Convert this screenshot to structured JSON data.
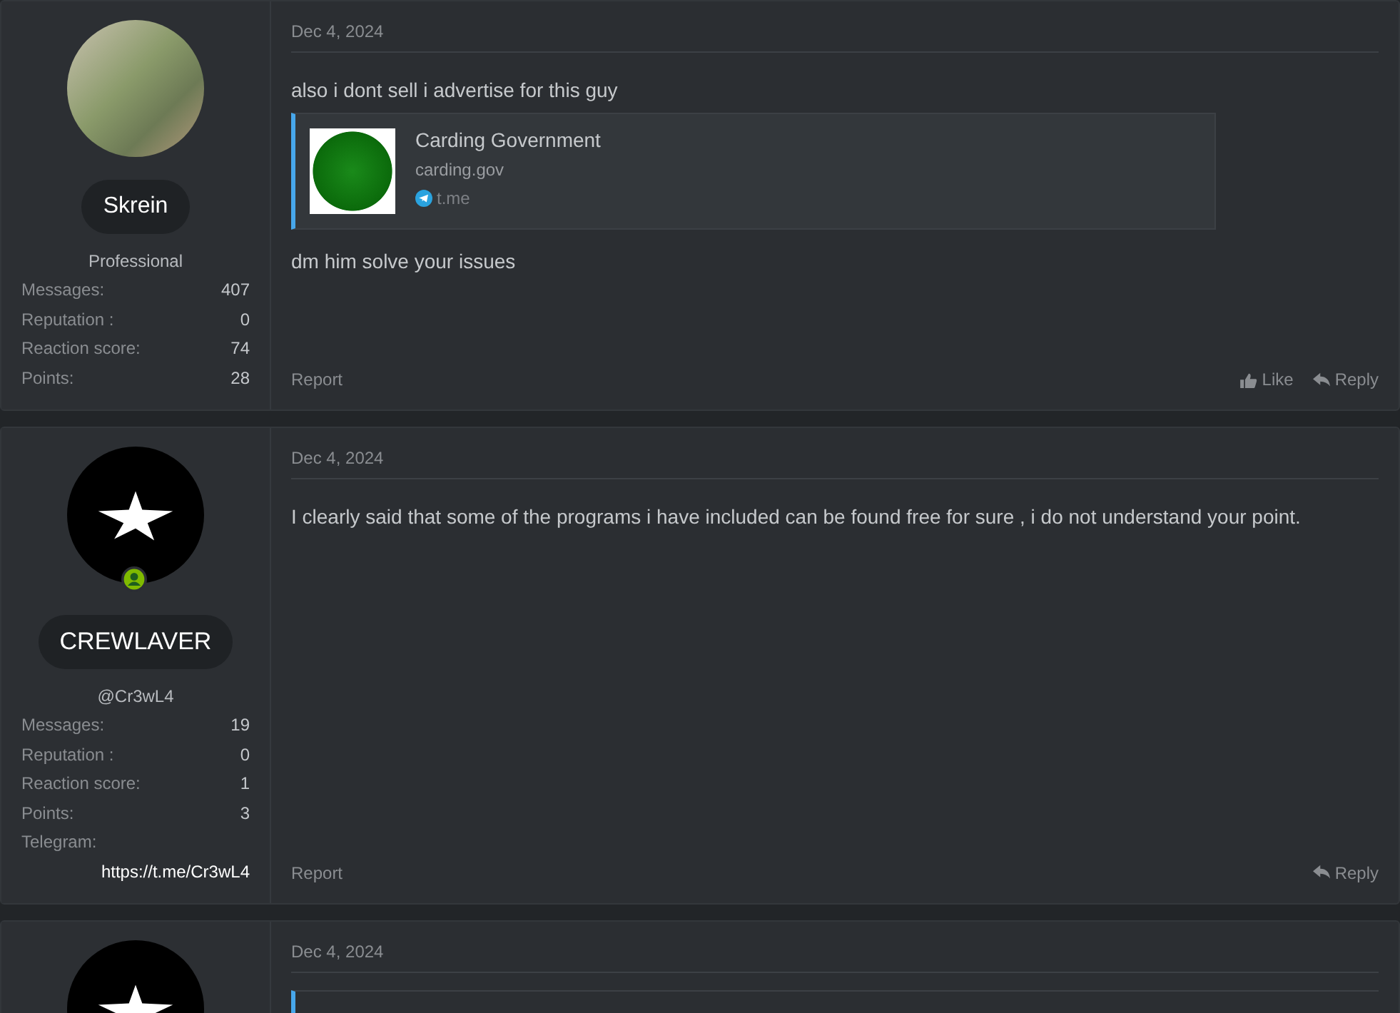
{
  "posts": [
    {
      "user": {
        "avatar": {
          "kind": "photo"
        },
        "online": false,
        "name": "Skrein",
        "subtitle": "Professional",
        "stats": [
          {
            "label": "Messages:",
            "value": "407"
          },
          {
            "label": "Reputation :",
            "value": "0"
          },
          {
            "label": "Reaction score:",
            "value": "74"
          },
          {
            "label": "Points:",
            "value": "28"
          }
        ]
      },
      "date": "Dec 4, 2024",
      "content": [
        {
          "kind": "text",
          "text": "also i dont sell i advertise for this guy"
        },
        {
          "kind": "embed",
          "title": "Carding Government",
          "domain": "carding.gov",
          "source": "t.me"
        },
        {
          "kind": "text",
          "text": "dm him solve your issues"
        }
      ],
      "report": "Report",
      "like": "Like",
      "reply": "Reply"
    },
    {
      "user": {
        "avatar": {
          "kind": "logo"
        },
        "online": true,
        "name": "CREWLAVER",
        "subtitle": "@Cr3wL4",
        "stats": [
          {
            "label": "Messages:",
            "value": "19"
          },
          {
            "label": "Reputation :",
            "value": "0"
          },
          {
            "label": "Reaction score:",
            "value": "1"
          },
          {
            "label": "Points:",
            "value": "3"
          }
        ],
        "field": {
          "label": "Telegram:",
          "value": "https://t.me/Cr3wL4"
        }
      },
      "date": "Dec 4, 2024",
      "content": [
        {
          "kind": "text",
          "text": "I clearly said that some of the programs i have included can be found free for sure , i do not understand your point."
        }
      ],
      "report": "Report",
      "reply": "Reply"
    },
    {
      "user": {
        "avatar": {
          "kind": "logo"
        }
      },
      "date": "Dec 4, 2024",
      "content": [
        {
          "kind": "quote"
        }
      ]
    }
  ]
}
